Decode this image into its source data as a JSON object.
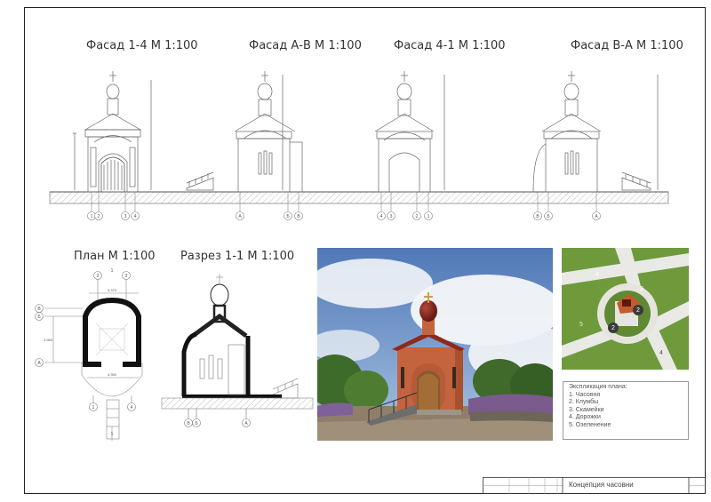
{
  "facades": [
    {
      "title": "Фасад 1-4 М 1:100",
      "axes": [
        "1",
        "2",
        "3",
        "4"
      ]
    },
    {
      "title": "Фасад А-В М 1:100",
      "axes": [
        "А",
        "Б",
        "В"
      ]
    },
    {
      "title": "Фасад 4-1 М 1:100",
      "axes": [
        "4",
        "3",
        "2",
        "1"
      ]
    },
    {
      "title": "Фасад В-А М 1:100",
      "axes": [
        "В",
        "Б",
        "А"
      ]
    }
  ],
  "plan": {
    "title": "План М 1:100",
    "dim_top": "3.370",
    "dim_side": "3.980",
    "dim_bottom": "4.390",
    "axes_top": [
      "2",
      "3"
    ],
    "axes_left": [
      "В",
      "Б",
      "А"
    ],
    "axes_bottom": [
      "1",
      "4"
    ],
    "section_mark": "1"
  },
  "section": {
    "title": "Разрез 1-1 М 1:100",
    "axes": [
      "В",
      "Б",
      "А"
    ]
  },
  "siteplan": {
    "labels": [
      "4",
      "3",
      "2",
      "2",
      "5",
      "4"
    ]
  },
  "legend": {
    "title": "Экспликация плана:",
    "items": [
      "1. Часовня",
      "2. Клумбы",
      "3. Скамейки",
      "4. Дорожки",
      "5. Озеленение"
    ]
  },
  "stamp": {
    "title": "Концепция часовни"
  },
  "colors": {
    "brick": "#c3643e",
    "dome": "#7a2418",
    "grass": "#6e9a3c",
    "sky": "#6f95c8",
    "lines": "#888888"
  }
}
